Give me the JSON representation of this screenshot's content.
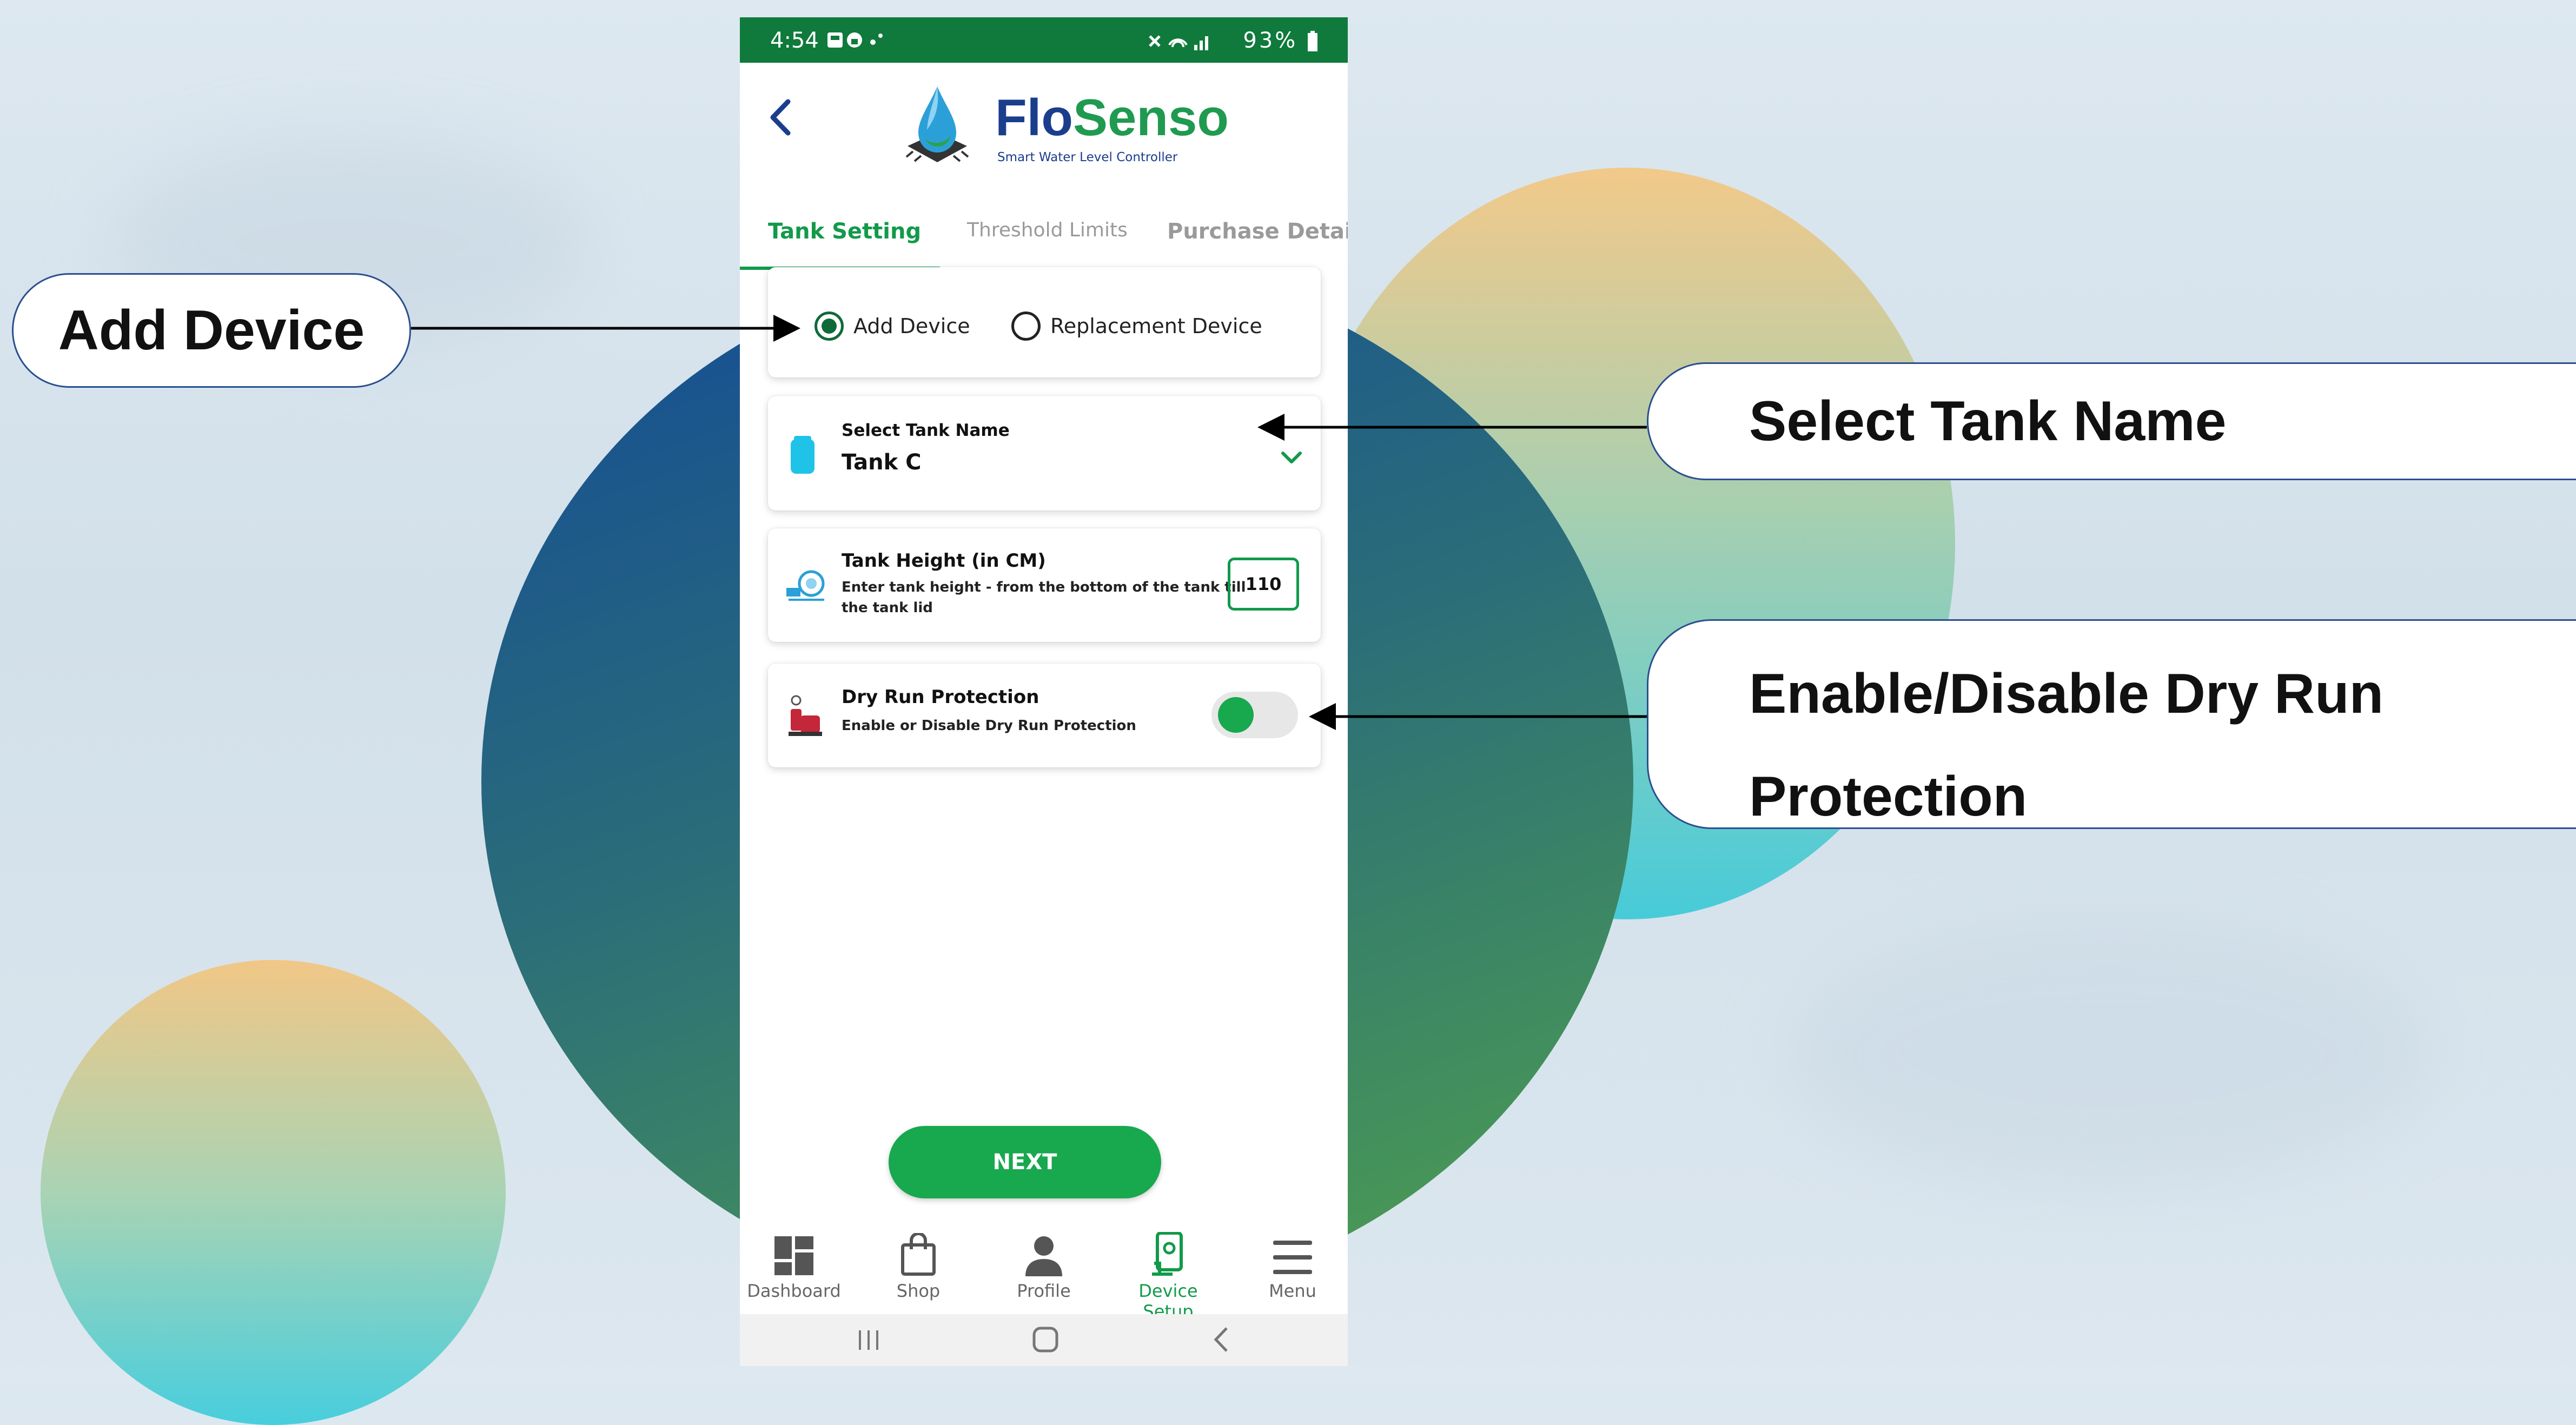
{
  "status_bar": {
    "time": "4:54",
    "battery": "93%"
  },
  "header": {
    "brand_part1": "Flo",
    "brand_part2": "Senso",
    "tagline": "Smart Water Level Controller"
  },
  "tabs": [
    {
      "label": "Tank Setting",
      "active": true
    },
    {
      "label": "Threshold Limits",
      "active": false
    },
    {
      "label": "Purchase Detail",
      "active": false
    }
  ],
  "device_type": {
    "options": [
      {
        "label": "Add Device",
        "selected": true
      },
      {
        "label": "Replacement Device",
        "selected": false
      }
    ]
  },
  "tank_select": {
    "label": "Select Tank Name",
    "value": "Tank C"
  },
  "tank_height": {
    "title": "Tank Height (in CM)",
    "description_line1": "Enter tank height - from the bottom of the tank till",
    "description_line2": "the tank lid",
    "value": "110"
  },
  "dry_run": {
    "title": "Dry Run Protection",
    "description": "Enable or Disable Dry Run Protection",
    "enabled": true
  },
  "next_button": "NEXT",
  "bottom_nav": [
    {
      "label": "Dashboard",
      "icon": "dashboard-icon",
      "active": false
    },
    {
      "label": "Shop",
      "icon": "shop-bag-icon",
      "active": false
    },
    {
      "label": "Profile",
      "icon": "profile-icon",
      "active": false
    },
    {
      "label": "Device Setup",
      "icon": "device-setup-icon",
      "active": true
    },
    {
      "label": "Menu",
      "icon": "menu-icon",
      "active": false
    }
  ],
  "callouts": {
    "add_device": "Add Device",
    "select_tank": "Select Tank Name",
    "dry_run_line1": "Enable/Disable Dry Run",
    "dry_run_line2": "Protection"
  },
  "colors": {
    "brand_green": "#129a4a",
    "brand_blue": "#1a3e8c",
    "status_bar": "#0f7a3b"
  }
}
